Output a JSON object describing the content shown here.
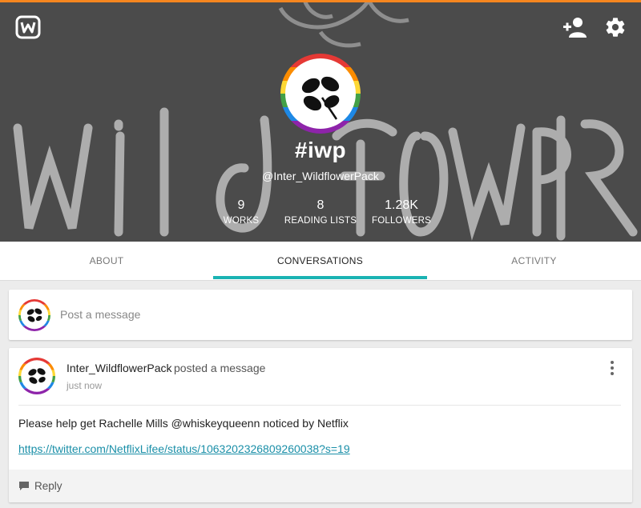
{
  "app": {
    "logo_icon": "wattpad-logo-icon",
    "accent_color": "#f5861f",
    "tab_indicator_color": "#1ab3b3"
  },
  "header": {
    "actions": [
      "add-user-icon",
      "gear-icon"
    ]
  },
  "profile": {
    "name": "#iwp",
    "handle": "@Inter_WildflowerPack",
    "stats": [
      {
        "value": "9",
        "label": "WORKS"
      },
      {
        "value": "8",
        "label": "READING LISTS"
      },
      {
        "value": "1.28K",
        "label": "FOLLOWERS"
      }
    ]
  },
  "tabs": [
    {
      "label": "ABOUT",
      "active": false
    },
    {
      "label": "CONVERSATIONS",
      "active": true
    },
    {
      "label": "ACTIVITY",
      "active": false
    }
  ],
  "composer": {
    "placeholder": "Post a message"
  },
  "message": {
    "author": "Inter_WildflowerPack",
    "action": "posted a message",
    "time": "just now",
    "text": "Please help get Rachelle Mills @whiskeyqueenn noticed by Netflix",
    "link": "https://twitter.com/NetflixLifee/status/1063202326809260038?s=19",
    "reply_label": "Reply"
  }
}
